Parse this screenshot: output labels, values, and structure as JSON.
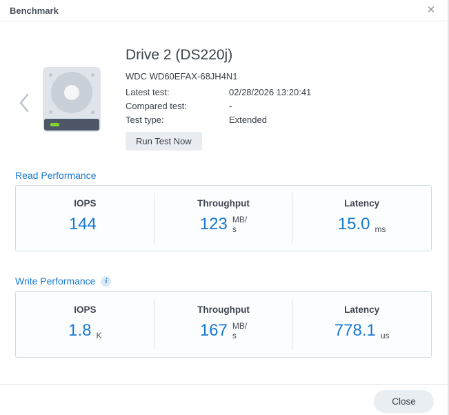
{
  "dialog": {
    "title": "Benchmark",
    "close_icon": "✕"
  },
  "drive": {
    "title": "Drive 2 (DS220j)",
    "model": "WDC WD60EFAX-68JH4N1",
    "details": [
      {
        "label": "Latest test:",
        "value": "02/28/2026 13:20:41"
      },
      {
        "label": "Compared test:",
        "value": "-"
      },
      {
        "label": "Test type:",
        "value": "Extended"
      }
    ],
    "run_test_label": "Run Test Now"
  },
  "panels": [
    {
      "title": "Read Performance",
      "metrics": [
        {
          "label": "IOPS",
          "value": "144",
          "unit_top": "",
          "unit_bottom": ""
        },
        {
          "label": "Throughput",
          "value": "123",
          "unit_top": "MB/",
          "unit_bottom": "s"
        },
        {
          "label": "Latency",
          "value": "15.0",
          "unit_top": "",
          "unit_bottom": "ms"
        }
      ]
    },
    {
      "title": "Write Performance",
      "info_icon": "i",
      "metrics": [
        {
          "label": "IOPS",
          "value": "1.8",
          "unit_top": "",
          "unit_bottom": "K"
        },
        {
          "label": "Throughput",
          "value": "167",
          "unit_top": "MB/",
          "unit_bottom": "s"
        },
        {
          "label": "Latency",
          "value": "778.1",
          "unit_top": "",
          "unit_bottom": "us"
        }
      ]
    }
  ],
  "footer": {
    "close_label": "Close"
  },
  "colors": {
    "accent_blue": "#1778d2",
    "panel_border": "#cddae4",
    "led_green": "#85d42d",
    "drive_bar": "#4d5765"
  }
}
